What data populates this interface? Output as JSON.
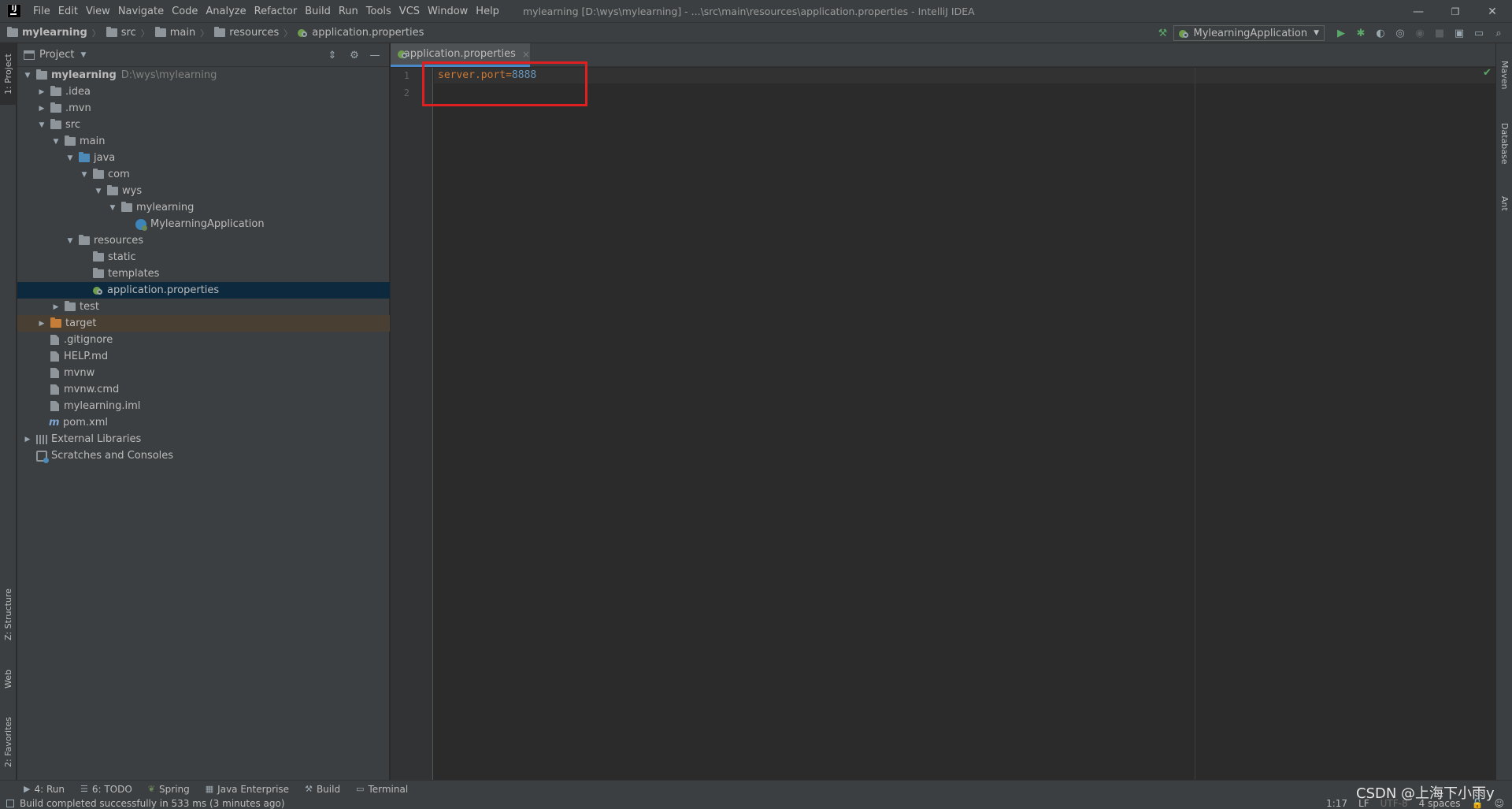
{
  "menubar": {
    "items": [
      "File",
      "Edit",
      "View",
      "Navigate",
      "Code",
      "Analyze",
      "Refactor",
      "Build",
      "Run",
      "Tools",
      "VCS",
      "Window",
      "Help"
    ],
    "window_title": "mylearning [D:\\wys\\mylearning] - ...\\src\\main\\resources\\application.properties - IntelliJ IDEA",
    "minimize": "—",
    "restore": "❐",
    "close": "✕"
  },
  "navbar": {
    "crumbs": [
      "mylearning",
      "src",
      "main",
      "resources",
      "application.properties"
    ],
    "run_config": "MylearningApplication"
  },
  "left_strip": {
    "project_tab": "1: Project",
    "structure_tab": "Z: Structure",
    "web_tab": "Web",
    "favorites_tab": "2: Favorites"
  },
  "right_strip": {
    "maven_tab": "Maven",
    "database_tab": "Database",
    "ant_tab": "Ant"
  },
  "project_panel": {
    "title": "Project",
    "tree": [
      {
        "label": "mylearning",
        "path": "D:\\wys\\mylearning"
      },
      {
        "label": ".idea"
      },
      {
        "label": ".mvn"
      },
      {
        "label": "src"
      },
      {
        "label": "main"
      },
      {
        "label": "java"
      },
      {
        "label": "com"
      },
      {
        "label": "wys"
      },
      {
        "label": "mylearning"
      },
      {
        "label": "MylearningApplication"
      },
      {
        "label": "resources"
      },
      {
        "label": "static"
      },
      {
        "label": "templates"
      },
      {
        "label": "application.properties"
      },
      {
        "label": "test"
      },
      {
        "label": "target"
      },
      {
        "label": ".gitignore"
      },
      {
        "label": "HELP.md"
      },
      {
        "label": "mvnw"
      },
      {
        "label": "mvnw.cmd"
      },
      {
        "label": "mylearning.iml"
      },
      {
        "label": "pom.xml"
      },
      {
        "label": "External Libraries"
      },
      {
        "label": "Scratches and Consoles"
      }
    ]
  },
  "editor": {
    "tab_label": "application.properties",
    "tab_close": "×",
    "line_numbers": [
      "1",
      "2"
    ],
    "code": {
      "key": "server.port",
      "eq": "=",
      "value": "8888"
    }
  },
  "bottom_tools": [
    {
      "label": "4: Run",
      "icon": "play-icon"
    },
    {
      "label": "6: TODO",
      "icon": "list-icon"
    },
    {
      "label": "Spring",
      "icon": "spring-icon"
    },
    {
      "label": "Java Enterprise",
      "icon": "java-enterprise-icon"
    },
    {
      "label": "Build",
      "icon": "hammer-icon"
    },
    {
      "label": "Terminal",
      "icon": "terminal-icon"
    }
  ],
  "status": {
    "message": "Build completed successfully in 533 ms (3 minutes ago)",
    "position": "1:17",
    "line_sep": "LF",
    "encoding": "UTF-8",
    "indent": "4 spaces"
  },
  "watermark": "CSDN @上海下小雨y",
  "colors": {
    "background": "#2b2b2b",
    "panel": "#3c3f41",
    "selection": "#0d293e",
    "highlight_box": "#e02020",
    "key": "#cc7832",
    "value": "#6897bb"
  }
}
